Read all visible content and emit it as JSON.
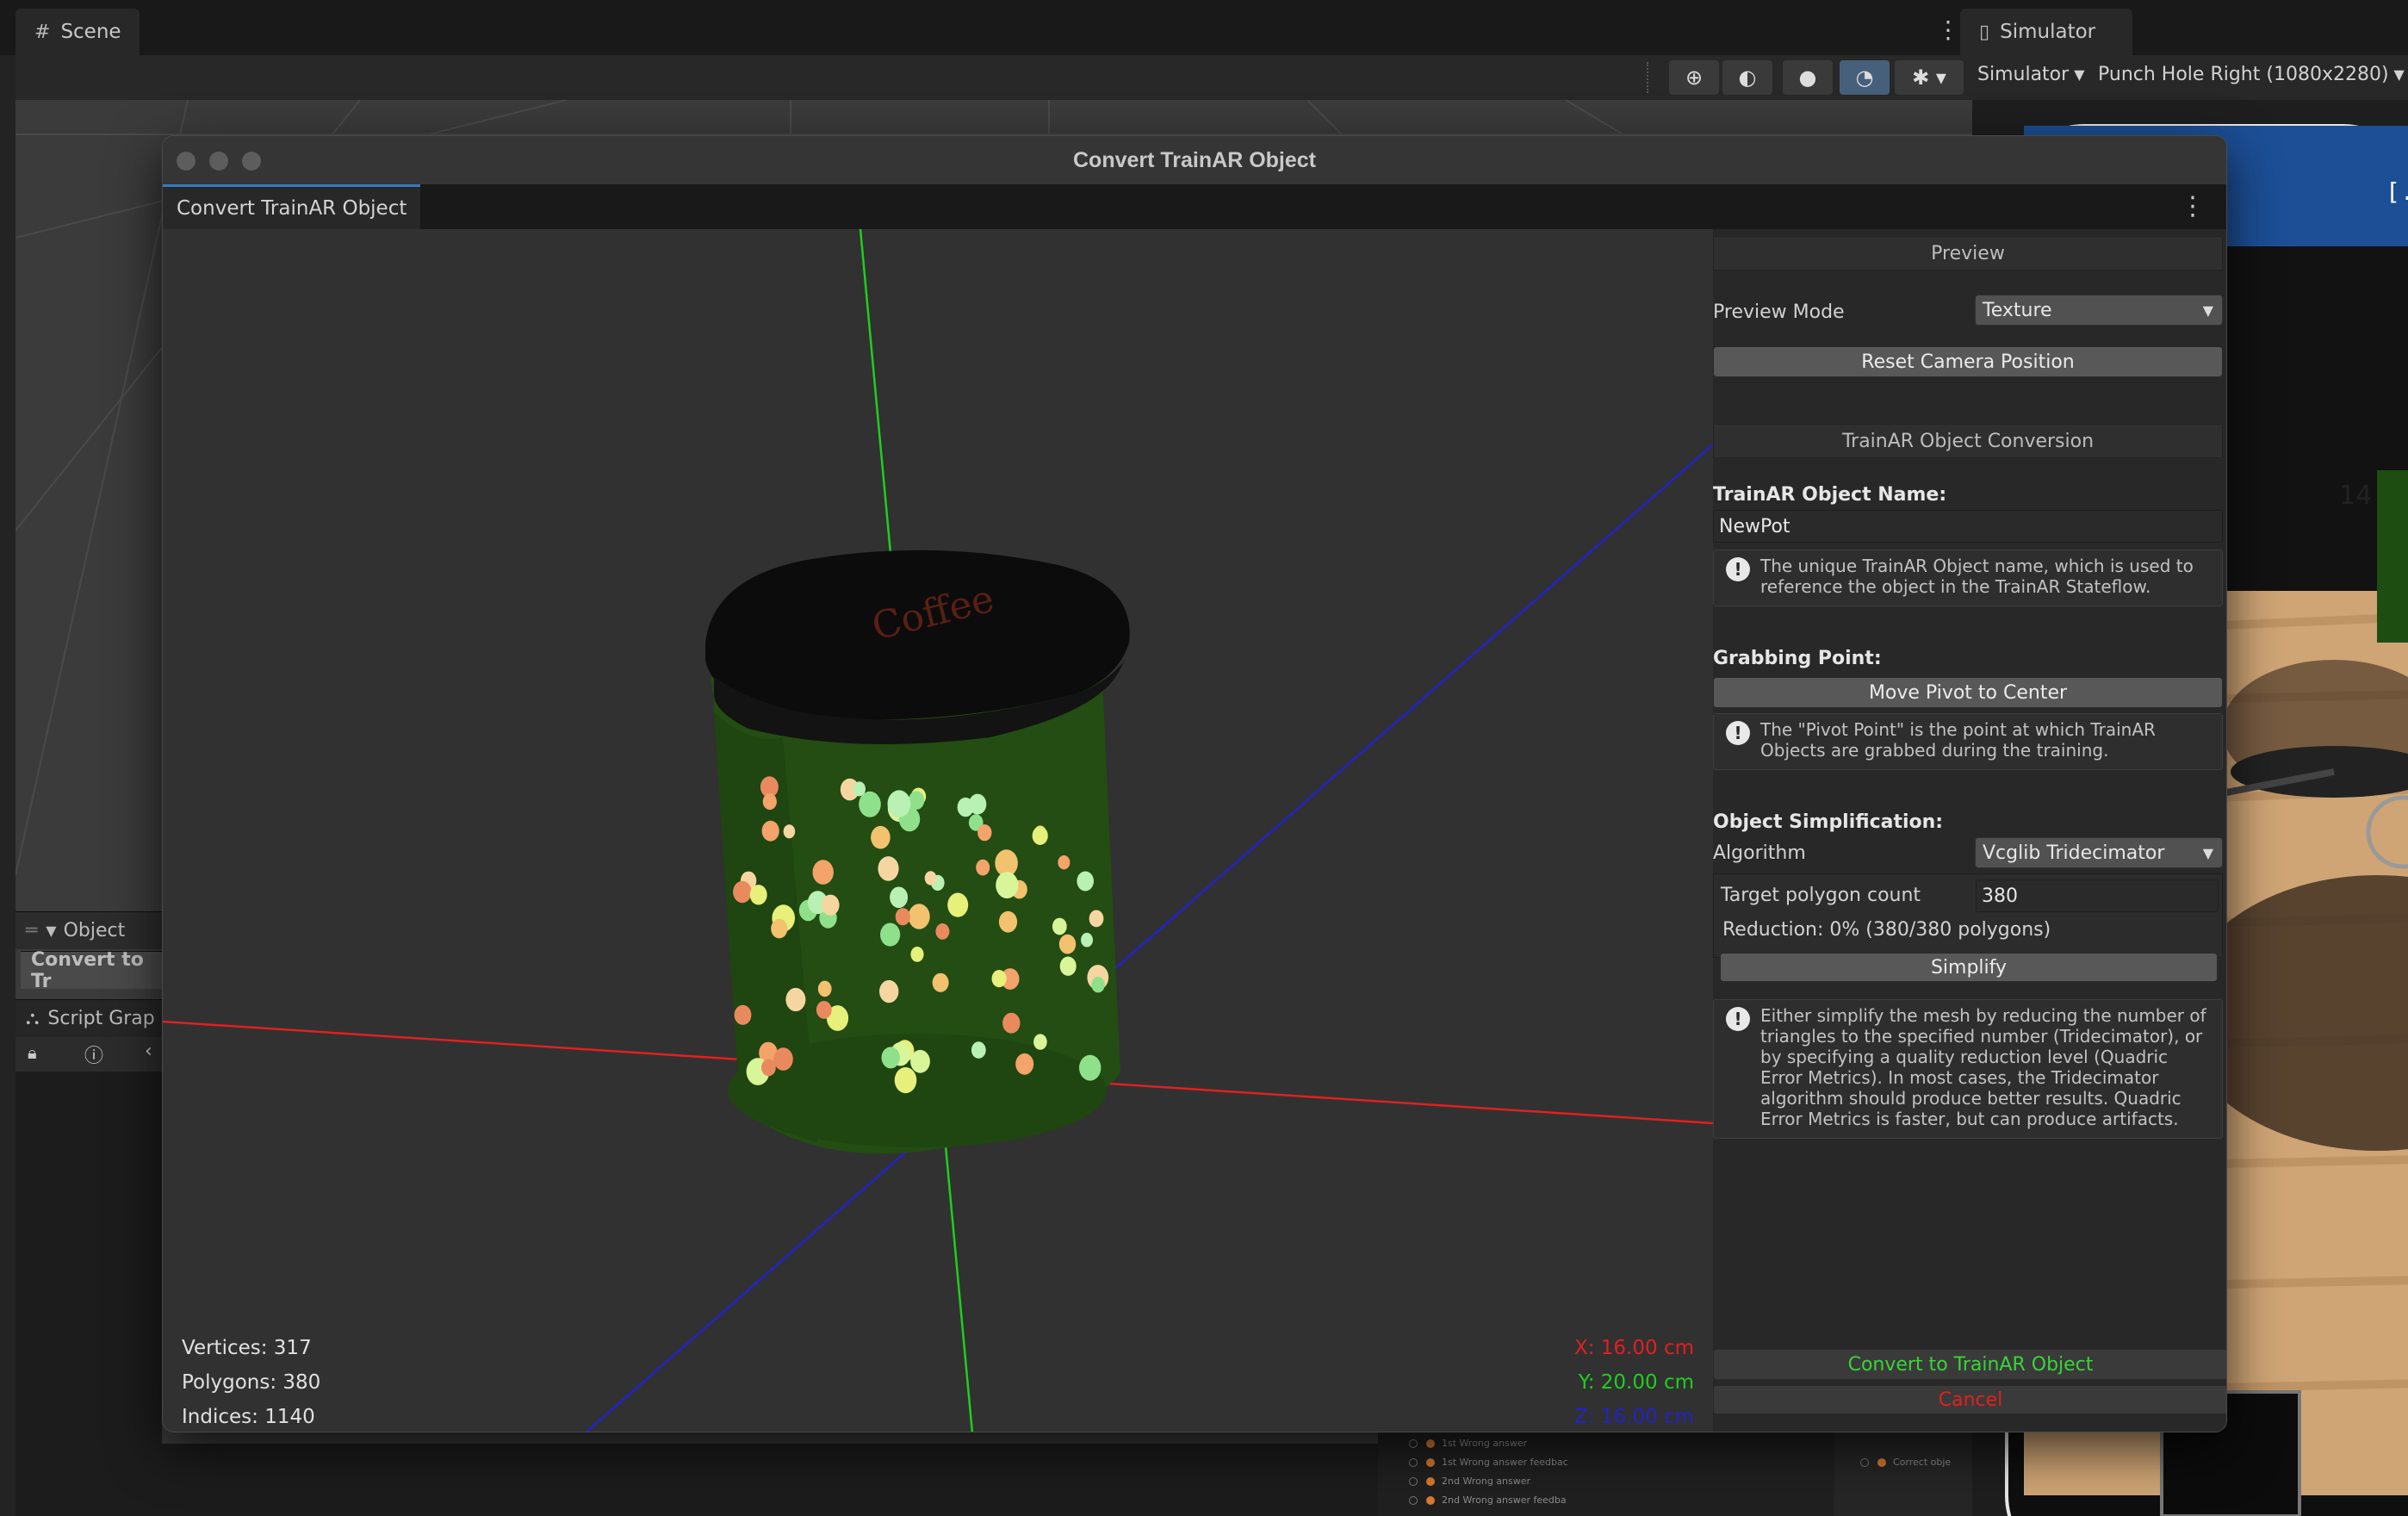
{
  "editor": {
    "scene_tab": "Scene",
    "simulator_tab": "Simulator",
    "simulator_mode": "Simulator",
    "device": "Punch Hole Right (1080x2280)",
    "object_panel": "Object",
    "object_item": "Convert to Tr",
    "script_graph_tab": "Script Grap",
    "sim_counter": "14",
    "sim_bracket": "[..",
    "graph_nodes": [
      "1st Wrong answer",
      "1st Wrong answer feedbac",
      "2nd Wrong answer",
      "2nd Wrong answer feedba"
    ],
    "graph_node_right": "Correct obje"
  },
  "window": {
    "title": "Convert TrainAR Object",
    "tab_label": "Convert TrainAR Object"
  },
  "viewport": {
    "vertices": "Vertices: 317",
    "polygons": "Polygons: 380",
    "indices": "Indices: 1140",
    "dim_x": "X: 16.00 cm",
    "dim_y": "Y: 20.00 cm",
    "dim_z": "Z: 16.00 cm",
    "lid_text": "Coffee",
    "axis_colors": {
      "x": "#e02020",
      "y": "#1ecf1e",
      "z": "#2222c8"
    }
  },
  "settings": {
    "preview_header": "Preview",
    "preview_mode_label": "Preview Mode",
    "preview_mode_value": "Texture",
    "reset_camera_label": "Reset Camera Position",
    "conversion_header": "TrainAR Object Conversion",
    "object_name_label": "TrainAR Object Name:",
    "object_name_value": "NewPot",
    "object_name_help": "The unique TrainAR Object name, which is used to reference the object in the TrainAR Stateflow.",
    "grabbing_label": "Grabbing Point:",
    "move_pivot_label": "Move Pivot to Center",
    "pivot_help": "The \"Pivot Point\" is the point at which TrainAR Objects are grabbed during the training.",
    "simplification_label": "Object Simplification:",
    "algorithm_label": "Algorithm",
    "algorithm_value": "Vcglib Tridecimator",
    "target_polygon_label": "Target polygon count",
    "target_polygon_value": "380",
    "reduction_text": "Reduction: 0% (380/380 polygons)",
    "simplify_label": "Simplify",
    "simplify_help": "Either simplify the mesh by reducing the number of triangles to the specified number (Tridecimator), or by specifying a quality reduction level (Quadric Error Metrics). In most cases, the Tridecimator algorithm should produce better results. Quadric Error Metrics is faster, but can produce artifacts.",
    "convert_label": "Convert to TrainAR Object",
    "convert_color": "#39d439",
    "cancel_label": "Cancel",
    "cancel_color": "#e02020"
  }
}
